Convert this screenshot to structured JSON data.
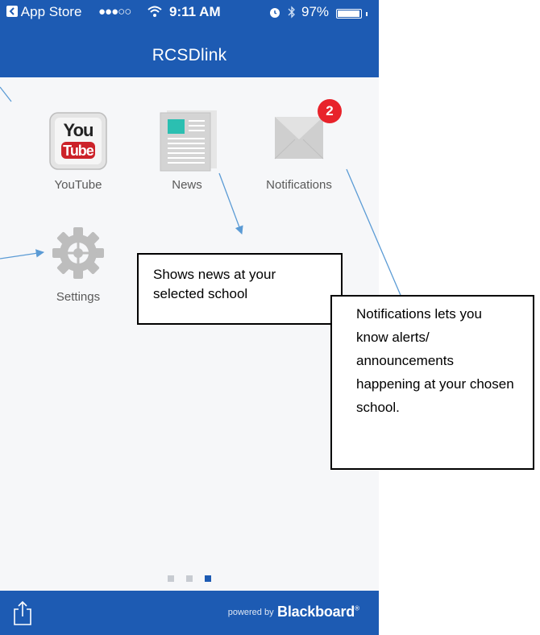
{
  "status_bar": {
    "back_app": "App Store",
    "signal": "●●●○○",
    "time": "9:11 AM",
    "battery_percent": "97%",
    "battery_level": 0.97
  },
  "nav": {
    "title": "RCSDlink"
  },
  "apps": [
    {
      "label": "YouTube",
      "icon": "youtube-icon",
      "icon_text_top": "You",
      "icon_text_bottom": "Tube"
    },
    {
      "label": "News",
      "icon": "newspaper-icon"
    },
    {
      "label": "Notifications",
      "icon": "envelope-icon",
      "badge": "2"
    },
    {
      "label": "Settings",
      "icon": "gear-icon"
    }
  ],
  "pager": {
    "pages": 3,
    "current": 3
  },
  "bottom_bar": {
    "share_icon": "share-icon",
    "powered_by": "powered by",
    "brand": "Blackboard",
    "trademark": "®"
  },
  "annotations": {
    "news_callout": "Shows news at your selected school",
    "notifications_callout": "Notifications lets you know alerts/ announcements happening at your chosen school."
  },
  "colors": {
    "brand_blue": "#1d5bb3",
    "badge_red": "#e8232b",
    "arrow_blue": "#5b9bd5"
  }
}
